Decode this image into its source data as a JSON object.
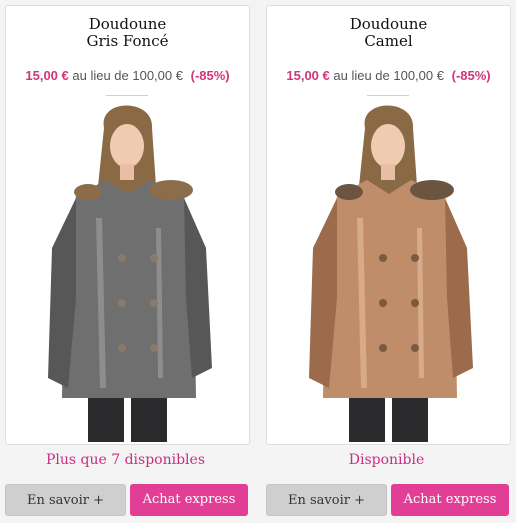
{
  "products": [
    {
      "title_line1": "Doudoune",
      "title_line2": "Gris Foncé",
      "price_now": "15,00 €",
      "price_text": "au lieu de 100,00 €",
      "discount": "(-85%)",
      "availability": "Plus que 7 disponibles",
      "more_label": "En savoir +",
      "buy_label": "Achat express",
      "jacket_color": "#6f6f6f",
      "jacket_shade": "#575757",
      "jacket_light": "#9a9a9a"
    },
    {
      "title_line1": "Doudoune",
      "title_line2": "Camel",
      "price_now": "15,00 €",
      "price_text": "au lieu de 100,00 €",
      "discount": "(-85%)",
      "availability": "Disponible",
      "more_label": "En savoir +",
      "buy_label": "Achat express",
      "jacket_color": "#c08d6a",
      "jacket_shade": "#9b6b4c",
      "jacket_light": "#e2b896"
    }
  ],
  "colors": {
    "accent": "#e23e96",
    "availability": "#c72d85",
    "price": "#d1357a",
    "secondary_button": "#cfcfcf"
  }
}
